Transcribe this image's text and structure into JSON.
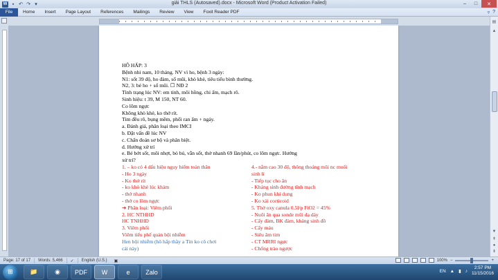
{
  "window": {
    "title": "giải THLS (Autosaved).docx  -  Microsoft Word (Product Activation Failed)",
    "app_logo": "W"
  },
  "ribbon": {
    "tabs": [
      "File",
      "Home",
      "Insert",
      "Page Layout",
      "References",
      "Mailings",
      "Review",
      "View",
      "Foxit Reader PDF"
    ]
  },
  "document": {
    "lines": [
      "HÔ HẤP: 3",
      "Bệnh nhi nam, 10 tháng. NV vì ho, bệnh 3 ngày:",
      "N1: sốt 39 độ, ho đàm, sổ mũi, khò khè, tiêu tiểu bình thường.",
      "N2, 3: bé ho + sổ mũi. ☐ NĐ 2",
      "Tình trạng lúc NV: em tỉnh, môi hồng, chi ấm, mạch rõ.",
      "Sinh hiệu: t 39, M 150, NT 60.",
      "Co lõm ngực",
      "Không khò khè, ko thở rít.",
      "Tim đều rõ, bụng mềm, phổi ran ẩm + ngáy.",
      "a.  Đánh giá, phân loại theo IMCI",
      "b.  Đặt vấn đề lúc NV",
      "c.  Chẩn đoán sơ bộ và phân biệt.",
      "d.  Hướng xử trí",
      "e.  Bé bớt sốt, môi nhợt, bỏ bú, vẫn sốt, thở nhanh 69 lần/phút, co lõm ngực. Hướng",
      "xử trí?"
    ],
    "col1": [
      {
        "text": "1. – ko có 4 dấu hiệu nguy hiểm toàn thân",
        "color": "red"
      },
      {
        "text": "- Ho 3 ngày",
        "color": "red"
      },
      {
        "text": "- Ko thở rít",
        "color": "red"
      },
      {
        "text": "- ko khò khè lúc khám",
        "color": "red"
      },
      {
        "text": "- thở nhanh",
        "color": "red"
      },
      {
        "text": "- thở co lõm ngực",
        "color": "red"
      },
      {
        "text": "➔ Phân loại: Viêm phổi",
        "color": "red"
      },
      {
        "text": "2. HC NTHHD",
        "color": "red"
      },
      {
        "text": "HC TNHHD",
        "color": "red"
      },
      {
        "text": "3. Viêm phổi",
        "color": "red"
      },
      {
        "text": "Viêm tiểu phế quản bội nhiễm",
        "color": "red"
      },
      {
        "text": "Hen bội nhiễm (hô hấp thầy a Tín ko cô chơi",
        "color": "blue"
      },
      {
        "text": "cái này)",
        "color": "blue"
      }
    ],
    "col2": [
      {
        "text": "4.- nằm cao 30 độ, thông thoáng mũi nc muối",
        "color": "red"
      },
      {
        "text": "sinh lí",
        "color": "red"
      },
      {
        "text": "- Tiếp tục cho ăn",
        "color": "red"
      },
      {
        "text": "- Kháng sinh đường tĩnh mạch",
        "color": "red"
      },
      {
        "text": "- Ko phun khí dung",
        "color": "red"
      },
      {
        "text": "- Ko xài corticoid",
        "color": "red"
      },
      {
        "text": "5. Thở oxy canula 0.5l/p FiO2 = 45%",
        "color": "red"
      },
      {
        "text": "- Nuôi ăn qua sonde mũi dạ dày",
        "color": "red"
      },
      {
        "text": "- Cấy đàm, BK đàm, kháng sinh đồ",
        "color": "red"
      },
      {
        "text": "- Cấy máu",
        "color": "red"
      },
      {
        "text": "- Siêu âm tim",
        "color": "red"
      },
      {
        "text": "- CT MRRI ngực",
        "color": "red"
      },
      {
        "text": "- Chống trào ngược",
        "color": "red"
      }
    ]
  },
  "status": {
    "page": "Page: 17 of 17",
    "words": "Words: 5,466",
    "language": "English (U.S.)",
    "zoom": "100%",
    "zoom_fraction": 0.5
  },
  "taskbar": {
    "language": "EN",
    "time": "2:57 PM",
    "date": "11/15/2016",
    "apps": [
      "folder",
      "chrome",
      "pdf",
      "word",
      "ie",
      "zalo"
    ],
    "app_labels": [
      "📁",
      "◉",
      "PDF",
      "W",
      "e",
      "Zalo"
    ]
  },
  "colors": {
    "red": "#d62020",
    "blue": "#2e6fb7",
    "accent": "#2b579a"
  }
}
